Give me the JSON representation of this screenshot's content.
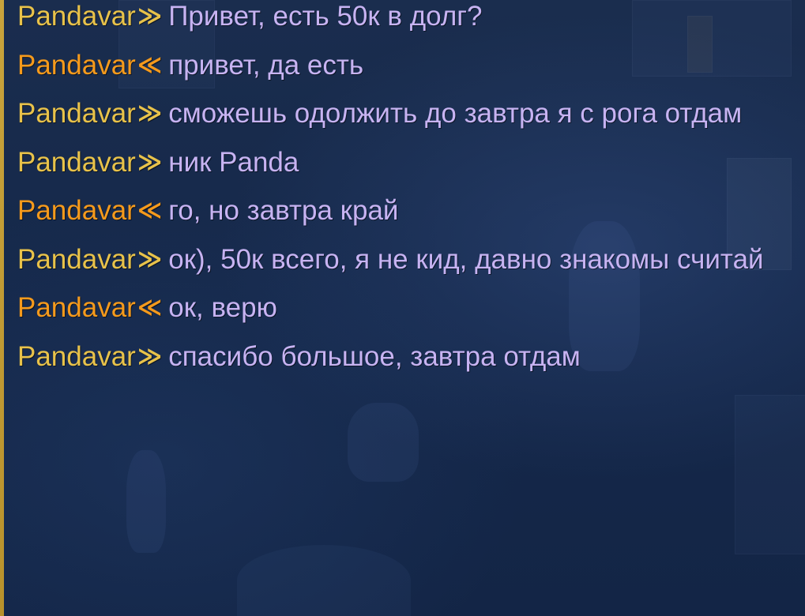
{
  "chat": {
    "messages": [
      {
        "sender": "Pandavar",
        "direction": "outgoing",
        "arrow": "≫",
        "text": "Привет, есть 50к в долг?"
      },
      {
        "sender": "Pandavar",
        "direction": "incoming",
        "arrow": "≪",
        "text": "привет, да есть"
      },
      {
        "sender": "Pandavar",
        "direction": "outgoing",
        "arrow": "≫",
        "text": "сможешь одолжить до завтра я с рога отдам"
      },
      {
        "sender": "Pandavar",
        "direction": "outgoing",
        "arrow": "≫",
        "text": "ник Panda"
      },
      {
        "sender": "Pandavar",
        "direction": "incoming",
        "arrow": "≪",
        "text": "го, но завтра край"
      },
      {
        "sender": "Pandavar",
        "direction": "outgoing",
        "arrow": "≫",
        "text": "ок), 50к всего, я не кид, давно знакомы считай"
      },
      {
        "sender": "Pandavar",
        "direction": "incoming",
        "arrow": "≪",
        "text": "ок, верю"
      },
      {
        "sender": "Pandavar",
        "direction": "outgoing",
        "arrow": "≫",
        "text": "спасибо большое, завтра отдам"
      }
    ]
  },
  "colors": {
    "sender_outgoing": "#e8c24a",
    "sender_incoming": "#f59a1c",
    "message_text": "#c7b3f2",
    "background": "#15284a"
  }
}
